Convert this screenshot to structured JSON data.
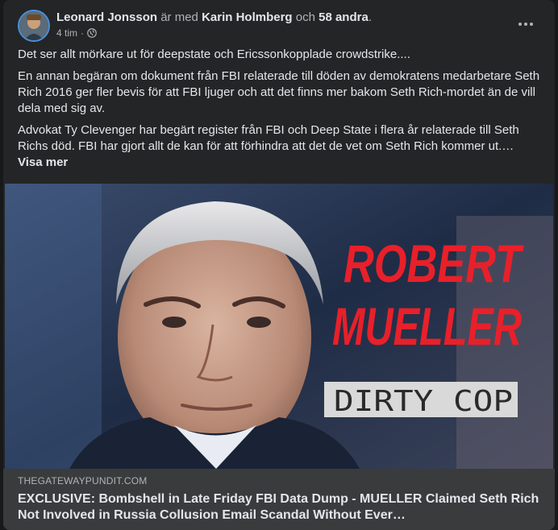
{
  "post": {
    "author": "Leonard Jonsson",
    "with_text": " är med ",
    "tagged": "Karin Holmberg",
    "and_text": " och ",
    "others": "58 andra",
    "period": ".",
    "time": "4 tim",
    "time_sep": "·",
    "privacy_icon": "globe-icon",
    "paragraphs": [
      "Det ser allt mörkare ut för deepstate och Ericssonkopplade crowdstrike....",
      "En annan begäran om dokument från FBI relaterade till döden av demokratens medarbetare Seth Rich 2016 ger fler bevis för att FBI ljuger och att det finns mer bakom Seth Rich-mordet än de vill dela med sig av.",
      "Advokat Ty Clevenger har begärt register från FBI och Deep State i flera år relaterade till Seth Richs död. FBI har gjort allt de kan för att förhindra att det de vet om Seth Rich kommer ut.…"
    ],
    "see_more": "Visa mer"
  },
  "image": {
    "headline_line1": "ROBERT",
    "headline_line2": "MUELLER",
    "caption": "DIRTY COP"
  },
  "link": {
    "domain": "THEGATEWAYPUNDIT.COM",
    "title": "EXCLUSIVE: Bombshell in Late Friday FBI Data Dump - MUELLER Claimed Seth Rich Not Involved in Russia Collusion Email Scandal Without Ever…"
  },
  "colors": {
    "card_bg": "#242526",
    "text": "#e4e6eb",
    "secondary_text": "#b0b3b8",
    "headline_red": "#e8202a",
    "link_bar": "#3a3b3c"
  }
}
